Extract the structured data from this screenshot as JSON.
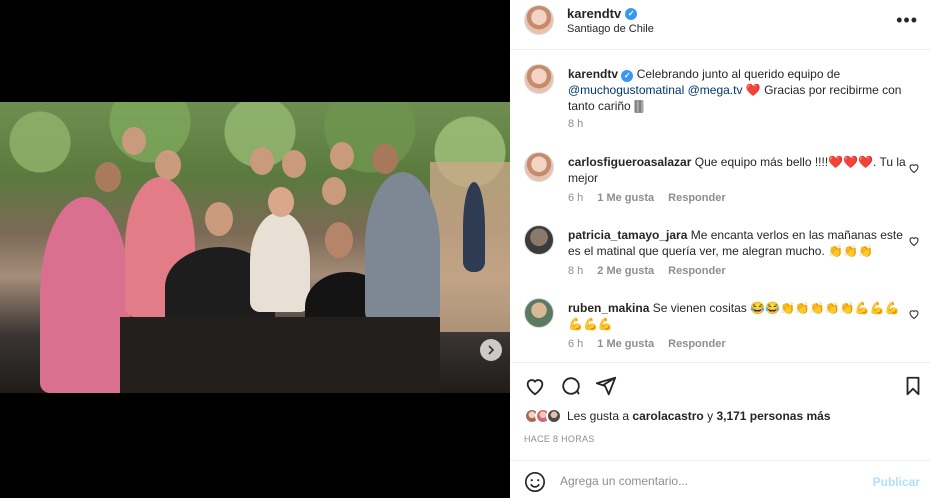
{
  "post": {
    "username": "karendtv",
    "location": "Santiago de Chile",
    "more_icon": "more-horizontal-icon"
  },
  "caption": {
    "username": "karendtv",
    "text_before": "Celebrando junto al querido equipo de ",
    "mention1": "@muchogustomatinal",
    "mention2": "@mega.tv",
    "text_after": " ❤️ Gracias por recibirme con tanto cariño 🀫",
    "time": "8 h"
  },
  "comments": [
    {
      "username": "carlosfigueroasalazar",
      "text": "Que equipo más bello !!!!❤️❤️❤️. Tu la mejor",
      "time": "6 h",
      "likes": "1 Me gusta",
      "reply": "Responder"
    },
    {
      "username": "patricia_tamayo_jara",
      "text": "Me encanta verlos en las mañanas este es el matinal que quería ver, me alegran mucho. 👏👏👏",
      "time": "8 h",
      "likes": "2 Me gusta",
      "reply": "Responder"
    },
    {
      "username": "ruben_makina",
      "text": "Se vienen cositas 😂😂👏👏👏👏👏💪💪💪💪💪💪",
      "time": "6 h",
      "likes": "1 Me gusta",
      "reply": "Responder"
    }
  ],
  "likes": {
    "prefix": "Les gusta a ",
    "user": "carolacastro",
    "middle": " y ",
    "count": "3,171 personas más"
  },
  "time_ago": "HACE 8 HORAS",
  "add_comment": {
    "placeholder": "Agrega un comentario...",
    "publish": "Publicar"
  },
  "colors": {
    "verified": "#3897f0",
    "link": "#00376b",
    "muted": "#8e8e8e",
    "publish_disabled": "#b2dffc"
  }
}
